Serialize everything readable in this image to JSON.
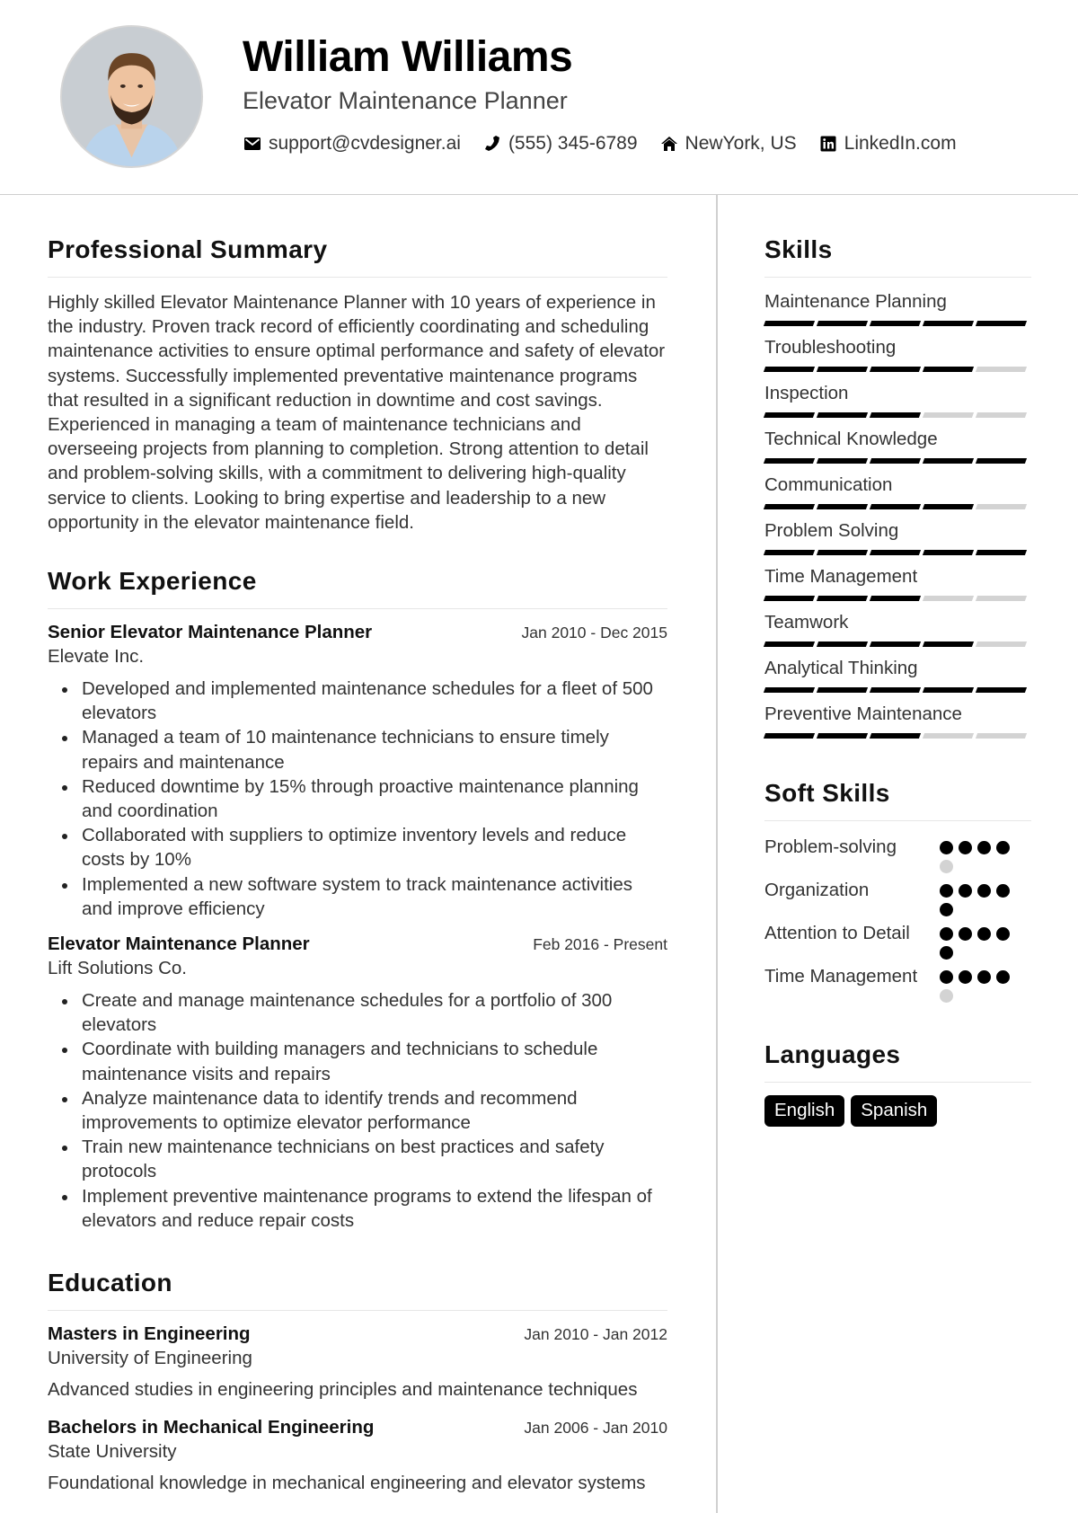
{
  "header": {
    "name": "William Williams",
    "title": "Elevator Maintenance Planner",
    "contacts": [
      {
        "icon": "envelope-icon",
        "text": "support@cvdesigner.ai"
      },
      {
        "icon": "phone-icon",
        "text": "(555) 345-6789"
      },
      {
        "icon": "home-icon",
        "text": "NewYork, US"
      },
      {
        "icon": "linkedin-icon",
        "text": "LinkedIn.com"
      }
    ]
  },
  "summary": {
    "heading": "Professional Summary",
    "text": "Highly skilled Elevator Maintenance Planner with 10 years of experience in the industry. Proven track record of efficiently coordinating and scheduling maintenance activities to ensure optimal performance and safety of elevator systems. Successfully implemented preventative maintenance programs that resulted in a significant reduction in downtime and cost savings. Experienced in managing a team of maintenance technicians and overseeing projects from planning to completion. Strong attention to detail and problem-solving skills, with a commitment to delivering high-quality service to clients. Looking to bring expertise and leadership to a new opportunity in the elevator maintenance field."
  },
  "experience": {
    "heading": "Work Experience",
    "jobs": [
      {
        "title": "Senior Elevator Maintenance Planner",
        "company": "Elevate Inc.",
        "dates": "Jan 2010 - Dec 2015",
        "bullets": [
          "Developed and implemented maintenance schedules for a fleet of 500 elevators",
          "Managed a team of 10 maintenance technicians to ensure timely repairs and maintenance",
          "Reduced downtime by 15% through proactive maintenance planning and coordination",
          "Collaborated with suppliers to optimize inventory levels and reduce costs by 10%",
          "Implemented a new software system to track maintenance activities and improve efficiency"
        ]
      },
      {
        "title": "Elevator Maintenance Planner",
        "company": "Lift Solutions Co.",
        "dates": "Feb 2016 - Present",
        "bullets": [
          "Create and manage maintenance schedules for a portfolio of 300 elevators",
          "Coordinate with building managers and technicians to schedule maintenance visits and repairs",
          "Analyze maintenance data to identify trends and recommend improvements to optimize elevator performance",
          "Train new maintenance technicians on best practices and safety protocols",
          "Implement preventive maintenance programs to extend the lifespan of elevators and reduce repair costs"
        ]
      }
    ]
  },
  "education": {
    "heading": "Education",
    "items": [
      {
        "degree": "Masters in Engineering",
        "school": "University of Engineering",
        "dates": "Jan 2010 - Jan 2012",
        "description": "Advanced studies in engineering principles and maintenance techniques"
      },
      {
        "degree": "Bachelors in Mechanical Engineering",
        "school": "State University",
        "dates": "Jan 2006 - Jan 2010",
        "description": "Foundational knowledge in mechanical engineering and elevator systems"
      }
    ]
  },
  "skills": {
    "heading": "Skills",
    "max_level": 5,
    "items": [
      {
        "name": "Maintenance Planning",
        "level": 5
      },
      {
        "name": "Troubleshooting",
        "level": 4
      },
      {
        "name": "Inspection",
        "level": 3
      },
      {
        "name": "Technical Knowledge",
        "level": 5
      },
      {
        "name": "Communication",
        "level": 4
      },
      {
        "name": "Problem Solving",
        "level": 5
      },
      {
        "name": "Time Management",
        "level": 3
      },
      {
        "name": "Teamwork",
        "level": 4
      },
      {
        "name": "Analytical Thinking",
        "level": 5
      },
      {
        "name": "Preventive Maintenance",
        "level": 3
      }
    ]
  },
  "soft_skills": {
    "heading": "Soft Skills",
    "max_level": 5,
    "items": [
      {
        "name": "Problem-solving",
        "level": 4
      },
      {
        "name": "Organization",
        "level": 5
      },
      {
        "name": "Attention to Detail",
        "level": 5
      },
      {
        "name": "Time Management",
        "level": 4
      }
    ]
  },
  "languages": {
    "heading": "Languages",
    "items": [
      "English",
      "Spanish"
    ]
  }
}
